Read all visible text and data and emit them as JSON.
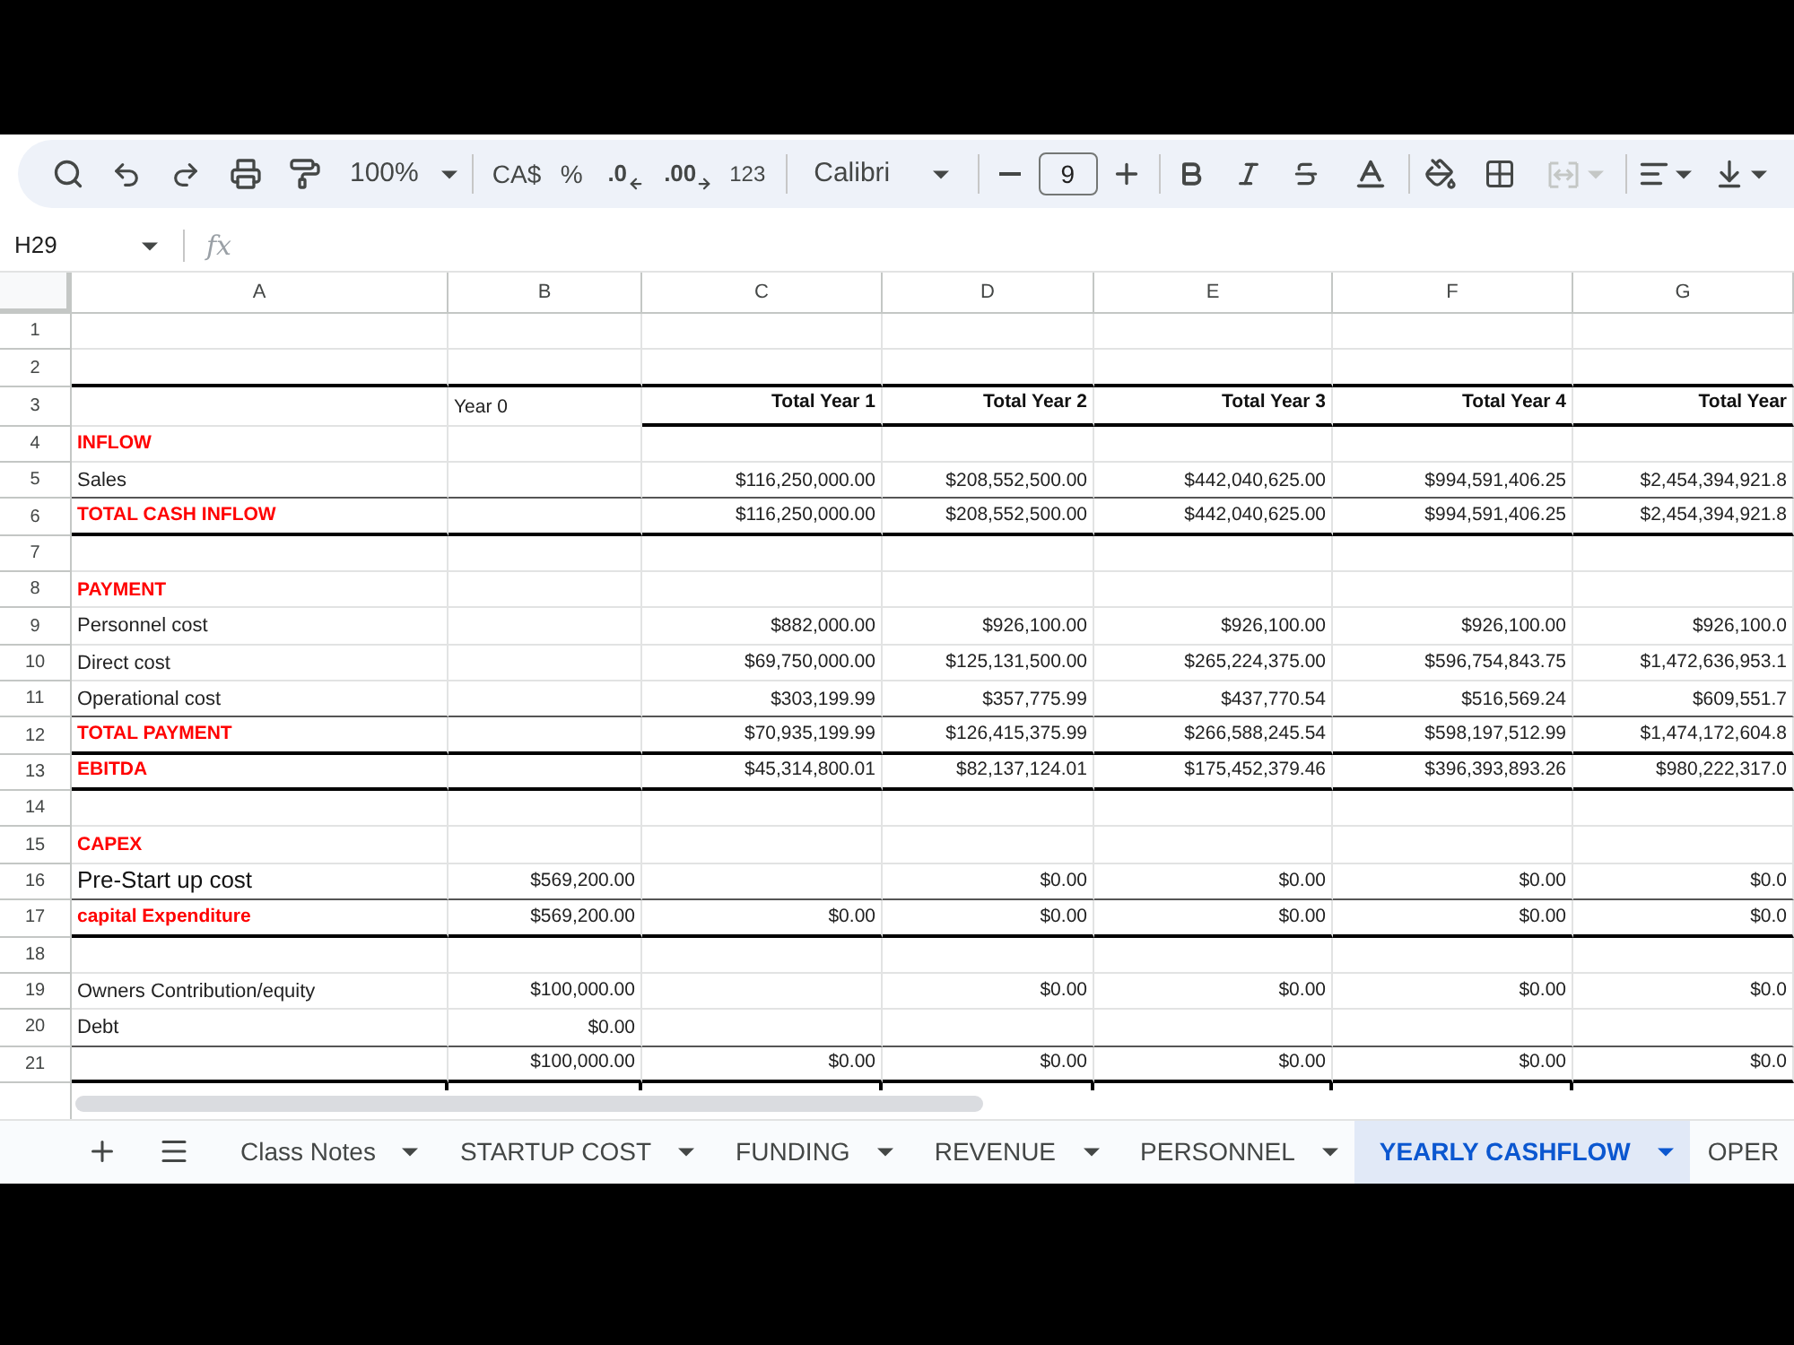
{
  "toolbar": {
    "zoom": "100%",
    "currency": "CA$",
    "percent": "%",
    "decrease_decimals": ".0",
    "increase_decimals": ".00",
    "number_format": "123",
    "font": "Calibri",
    "font_size": "9",
    "merge_disabled": true
  },
  "formula_bar": {
    "cell_ref": "H29",
    "function_label": "fx"
  },
  "columns": [
    "A",
    "B",
    "C",
    "D",
    "E",
    "F",
    "G"
  ],
  "rows": [
    {
      "number": "1",
      "kind": "blank",
      "border_below": false
    },
    {
      "number": "2",
      "kind": "blank",
      "border_below": true,
      "border_heavy": true
    },
    {
      "number": "3",
      "kind": "header",
      "border_below": true,
      "border_heavy": true,
      "cells": {
        "B": "Year 0",
        "C": "Total Year 1",
        "D": "Total Year 2",
        "E": "Total Year 3",
        "F": "Total Year 4",
        "G": "Total Year"
      }
    },
    {
      "number": "4",
      "kind": "heading",
      "label": "INFLOW",
      "border_below": false
    },
    {
      "number": "5",
      "kind": "item",
      "label": "Sales",
      "border_below": true,
      "border_heavy": false,
      "cells": {
        "C": "$116,250,000.00",
        "D": "$208,552,500.00",
        "E": "$442,040,625.00",
        "F": "$994,591,406.25",
        "G": "$2,454,394,921.8"
      }
    },
    {
      "number": "6",
      "kind": "heading",
      "label": "TOTAL CASH INFLOW",
      "border_below": true,
      "border_heavy": true,
      "cells": {
        "C": "$116,250,000.00",
        "D": "$208,552,500.00",
        "E": "$442,040,625.00",
        "F": "$994,591,406.25",
        "G": "$2,454,394,921.8"
      }
    },
    {
      "number": "7",
      "kind": "blank",
      "border_below": false
    },
    {
      "number": "8",
      "kind": "heading",
      "label": "PAYMENT",
      "border_below": false
    },
    {
      "number": "9",
      "kind": "item",
      "label": "Personnel cost",
      "border_below": false,
      "cells": {
        "C": "$882,000.00",
        "D": "$926,100.00",
        "E": "$926,100.00",
        "F": "$926,100.00",
        "G": "$926,100.0"
      }
    },
    {
      "number": "10",
      "kind": "item",
      "label": "Direct cost",
      "border_below": false,
      "cells": {
        "C": "$69,750,000.00",
        "D": "$125,131,500.00",
        "E": "$265,224,375.00",
        "F": "$596,754,843.75",
        "G": "$1,472,636,953.1"
      }
    },
    {
      "number": "11",
      "kind": "item",
      "label": "Operational cost",
      "border_below": true,
      "border_heavy": false,
      "cells": {
        "C": "$303,199.99",
        "D": "$357,775.99",
        "E": "$437,770.54",
        "F": "$516,569.24",
        "G": "$609,551.7"
      }
    },
    {
      "number": "12",
      "kind": "heading",
      "label": "TOTAL PAYMENT",
      "border_below": true,
      "border_heavy": true,
      "cells": {
        "C": "$70,935,199.99",
        "D": "$126,415,375.99",
        "E": "$266,588,245.54",
        "F": "$598,197,512.99",
        "G": "$1,474,172,604.8"
      }
    },
    {
      "number": "13",
      "kind": "heading",
      "label": "EBITDA",
      "border_below": true,
      "border_heavy": true,
      "cells": {
        "C": "$45,314,800.01",
        "D": "$82,137,124.01",
        "E": "$175,452,379.46",
        "F": "$396,393,893.26",
        "G": "$980,222,317.0"
      }
    },
    {
      "number": "14",
      "kind": "blank",
      "border_below": false
    },
    {
      "number": "15",
      "kind": "heading",
      "label": "CAPEX",
      "border_below": false
    },
    {
      "number": "16",
      "kind": "large_item",
      "label": "Pre-Start up cost",
      "border_below": true,
      "border_heavy": false,
      "cells": {
        "B": "$569,200.00",
        "D": "$0.00",
        "E": "$0.00",
        "F": "$0.00",
        "G": "$0.0"
      }
    },
    {
      "number": "17",
      "kind": "heading",
      "label": "capital Expenditure",
      "border_below": true,
      "border_heavy": true,
      "cells": {
        "B": "$569,200.00",
        "C": "$0.00",
        "D": "$0.00",
        "E": "$0.00",
        "F": "$0.00",
        "G": "$0.0"
      }
    },
    {
      "number": "18",
      "kind": "blank",
      "border_below": false
    },
    {
      "number": "19",
      "kind": "item",
      "label": "Owners Contribution/equity",
      "border_below": false,
      "cells": {
        "B": "$100,000.00",
        "D": "$0.00",
        "E": "$0.00",
        "F": "$0.00",
        "G": "$0.0"
      }
    },
    {
      "number": "20",
      "kind": "item",
      "label": "Debt",
      "border_below": true,
      "border_heavy": false,
      "cells": {
        "B": "$0.00"
      }
    },
    {
      "number": "21",
      "kind": "item",
      "border_below": true,
      "border_heavy": true,
      "cells": {
        "B": "$100,000.00",
        "C": "$0.00",
        "D": "$0.00",
        "E": "$0.00",
        "F": "$0.00",
        "G": "$0.0"
      }
    }
  ],
  "tabs": [
    {
      "label": "Class Notes",
      "selected": false
    },
    {
      "label": "STARTUP COST",
      "selected": false
    },
    {
      "label": "FUNDING",
      "selected": false
    },
    {
      "label": "REVENUE",
      "selected": false
    },
    {
      "label": "PERSONNEL",
      "selected": false
    },
    {
      "label": "YEARLY CASHFLOW",
      "selected": true
    },
    {
      "label": "OPER",
      "selected": false
    }
  ]
}
